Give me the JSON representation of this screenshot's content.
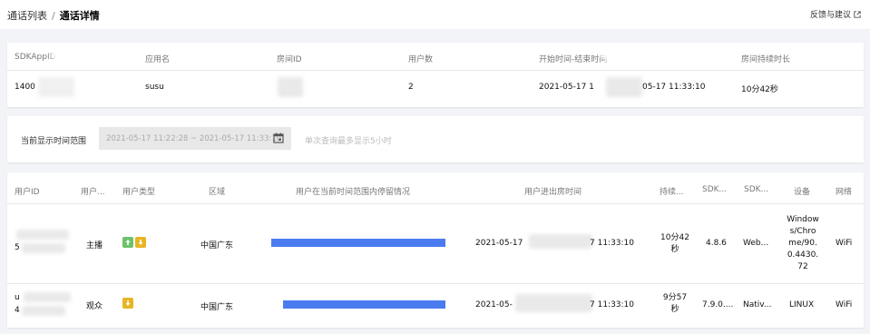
{
  "breadcrumb": {
    "parent": "通话列表",
    "separator": "/",
    "current": "通话详情"
  },
  "header": {
    "feedback": "反馈与建议"
  },
  "summary": {
    "headers": [
      "SDKAppID",
      "应用名",
      "房间ID",
      "用户数",
      "开始时间-结束时间",
      "房间持续时长"
    ],
    "appid": "1400",
    "app_name": "susu",
    "user_count": "2",
    "time_start": "2021-05-17 1",
    "time_end": "05-17 11:33:10",
    "duration": "10分42秒"
  },
  "time_range": {
    "label": "当前显示时间范围",
    "value": "2021-05-17 11:22:28 ~ 2021-05-17 11:33:10",
    "hint": "单次查询最多显示5小时"
  },
  "users_table": {
    "headers": [
      "用户ID",
      "用户...",
      "用户类型",
      "区域",
      "用户在当前时间范围内停留情况",
      "用户进出房时间",
      "持续...",
      "SDK...",
      "SDK...",
      "设备",
      "网络"
    ],
    "rows": [
      {
        "user_id_top": "",
        "user_id_bottom": "5",
        "role": "主播",
        "badges": [
          "up",
          "down"
        ],
        "region": "中国广东",
        "presence": [
          0.0,
          1.0
        ],
        "io_start": "2021-05-17",
        "io_end": "7 11:33:10",
        "duration_1": "10分42",
        "duration_2": "秒",
        "sdk_version": "4.8.6",
        "sdk_type": "Web...",
        "device_1": "Window",
        "device_2": "s/Chro",
        "device_3": "me/90.",
        "device_4": "0.4430.",
        "device_5": "72",
        "network": "WiFi"
      },
      {
        "user_id_top": "u",
        "user_id_bottom": "4",
        "role": "观众",
        "badges": [
          "down"
        ],
        "region": "中国广东",
        "presence": [
          0.07,
          1.0
        ],
        "io_start": "2021-05-",
        "io_end": "7 11:33:10",
        "duration_1": "9分57",
        "duration_2": "秒",
        "sdk_version": "7.9.0....",
        "sdk_type": "Nativ...",
        "device_1": "LINUX",
        "network": "WiFi"
      }
    ]
  },
  "colors": {
    "bar": "#4a7cf0",
    "badge_up": "#6cc26a",
    "badge_down": "#e8b423",
    "page_bg": "#f3f4f7"
  },
  "icons": {
    "external_link": "external-link-icon",
    "calendar": "calendar-icon",
    "arrow_up": "arrow-up-icon",
    "arrow_down": "arrow-down-icon"
  }
}
